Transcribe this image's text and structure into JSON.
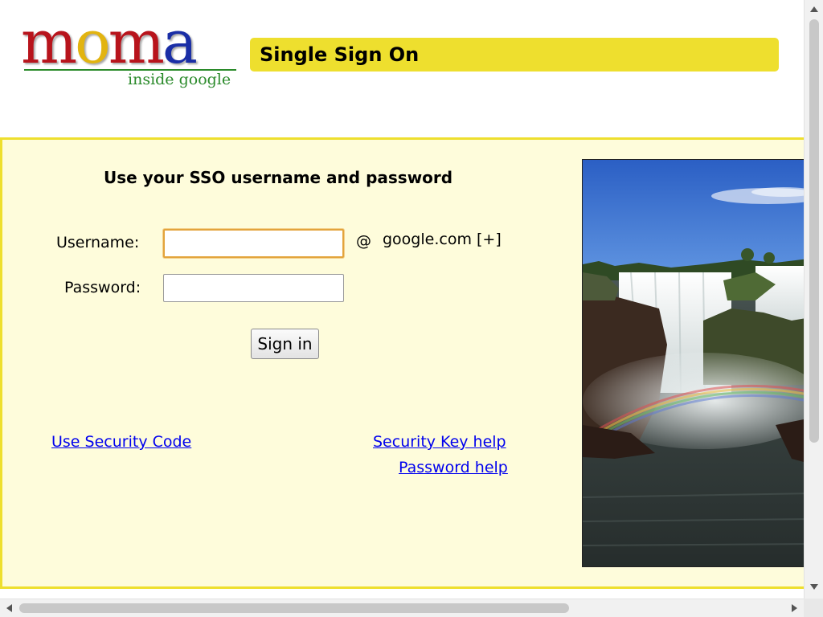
{
  "logo": {
    "letters": [
      "m",
      "o",
      "m",
      "a"
    ],
    "letter_colors": [
      "#b8141c",
      "#e2b410",
      "#b8141c",
      "#1a2ea6"
    ],
    "tagline": "inside google",
    "tagline_color": "#2a8a2a"
  },
  "header": {
    "title": "Single Sign On",
    "bar_color": "#eedf2e"
  },
  "login": {
    "heading": "Use your SSO username and password",
    "username_label": "Username:",
    "username_value": "",
    "password_label": "Password:",
    "password_value": "",
    "at_sign": "@",
    "domain_label": "google.com [+]",
    "signin_label": "Sign in"
  },
  "links": {
    "security_code": "Use Security Code",
    "security_key_help": "Security Key help",
    "password_help": "Password help"
  },
  "panel": {
    "background": "#fefcdb",
    "border": "#eedf2e"
  },
  "image": {
    "subject": "waterfall-with-rainbow"
  },
  "icons": {
    "scroll_up": "chevron-up-icon",
    "scroll_down": "chevron-down-icon",
    "scroll_left": "chevron-left-icon",
    "scroll_right": "chevron-right-icon"
  }
}
